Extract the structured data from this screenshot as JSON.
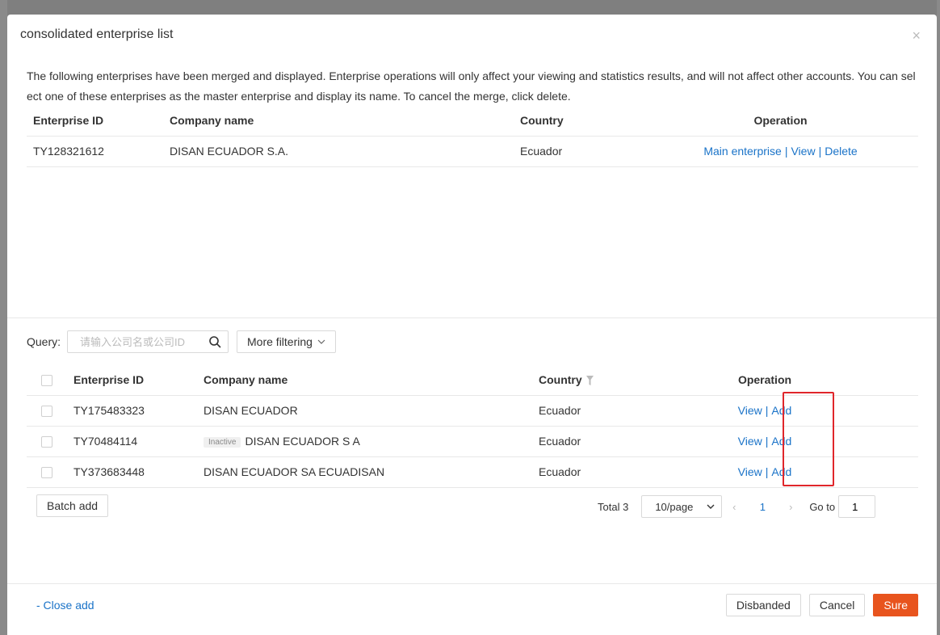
{
  "modal": {
    "title": "consolidated enterprise list",
    "close_glyph": "×",
    "description": "The following enterprises have been merged and displayed. Enterprise operations will only affect your viewing and statistics results, and will not affect other accounts. You can sel ect one of these enterprises as the master enterprise and display its name. To cancel the merge, click delete."
  },
  "merged_table": {
    "headers": {
      "id": "Enterprise ID",
      "name": "Company name",
      "country": "Country",
      "operation": "Operation"
    },
    "rows": [
      {
        "id": "TY128321612",
        "name": "DISAN ECUADOR S.A.",
        "country": "Ecuador",
        "ops": {
          "main": "Main enterprise",
          "view": "View",
          "delete": "Delete"
        }
      }
    ]
  },
  "query": {
    "label": "Query:",
    "placeholder": "请输入公司名或公司ID",
    "more_filtering": "More filtering"
  },
  "candidate_table": {
    "headers": {
      "id": "Enterprise ID",
      "name": "Company name",
      "country": "Country",
      "operation": "Operation"
    },
    "rows": [
      {
        "id": "TY175483323",
        "tag": "",
        "name": "DISAN ECUADOR",
        "country": "Ecuador",
        "view": "View",
        "add": "Add"
      },
      {
        "id": "TY70484114",
        "tag": "Inactive",
        "name": "DISAN ECUADOR S A",
        "country": "Ecuador",
        "view": "View",
        "add": "Add"
      },
      {
        "id": "TY373683448",
        "tag": "",
        "name": "DISAN ECUADOR SA ECUADISAN",
        "country": "Ecuador",
        "view": "View",
        "add": "Add"
      }
    ]
  },
  "pagination": {
    "batch_add": "Batch add",
    "total": "Total 3",
    "page_size": "10/page",
    "current_page": "1",
    "goto_label": "Go to",
    "goto_value": "1"
  },
  "footer": {
    "close_add": "- Close add",
    "disbanded": "Disbanded",
    "cancel": "Cancel",
    "sure": "Sure"
  },
  "colors": {
    "link": "#1a73c8",
    "primary": "#e8541e",
    "highlight": "#e0262b"
  }
}
